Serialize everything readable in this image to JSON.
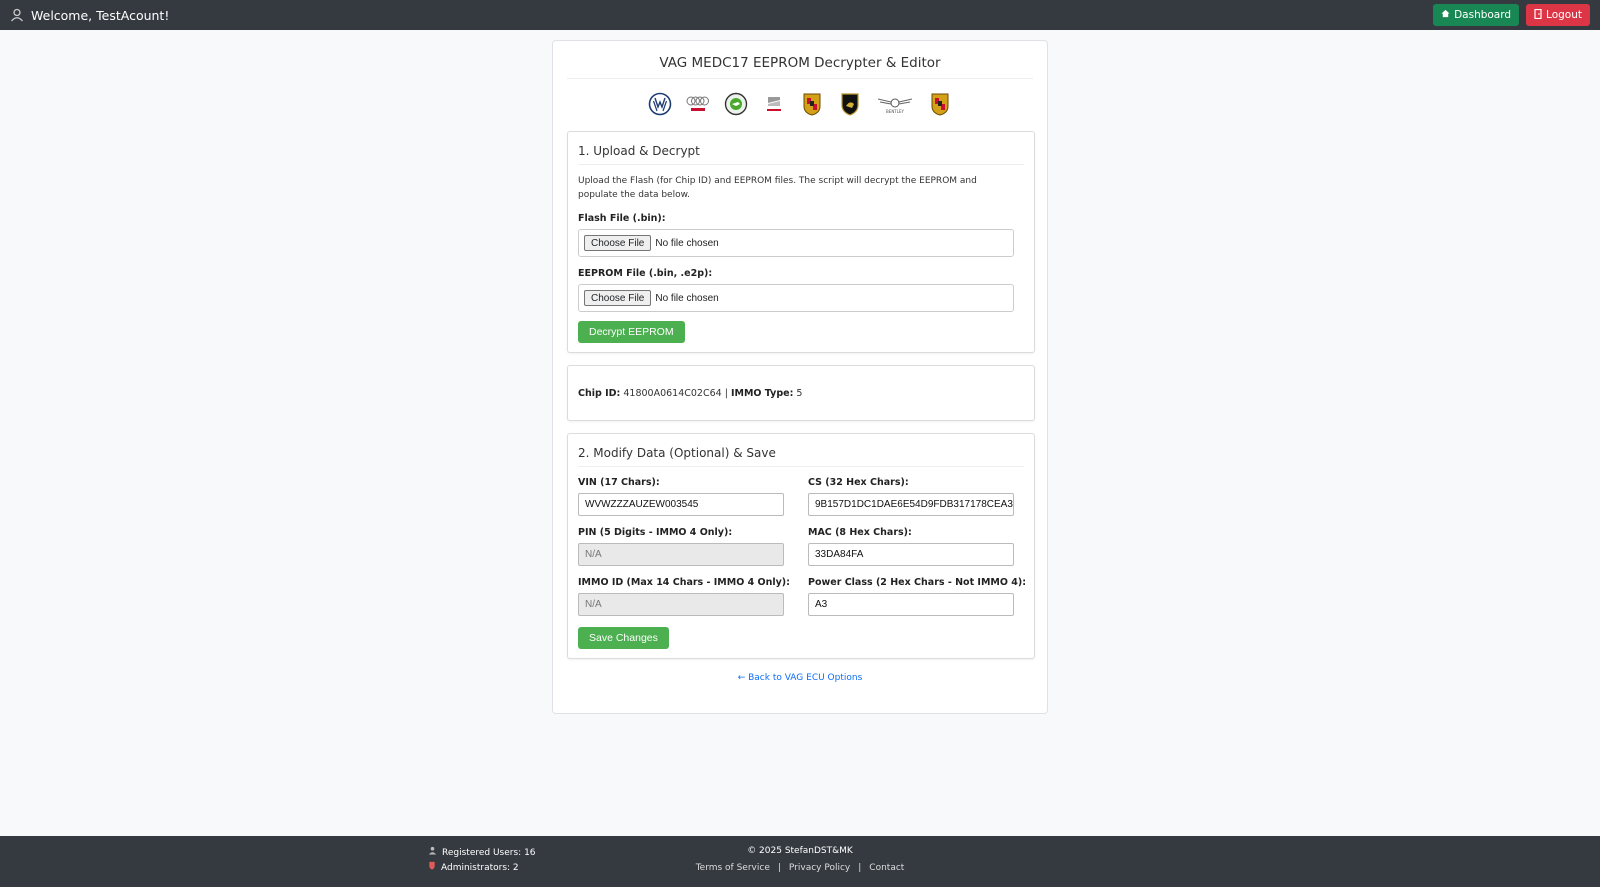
{
  "header": {
    "welcome_text": "Welcome, TestAcount!",
    "dashboard_label": "Dashboard",
    "logout_label": "Logout"
  },
  "page": {
    "title": "VAG MEDC17 EEPROM Decrypter & Editor",
    "brand_logos": [
      "vw-logo",
      "audi-logo",
      "skoda-logo",
      "seat-logo",
      "porsche-logo",
      "lamborghini-logo",
      "bentley-logo",
      "porsche-logo"
    ]
  },
  "upload": {
    "title": "1. Upload & Decrypt",
    "description": "Upload the Flash (for Chip ID) and EEPROM files. The script will decrypt the EEPROM and populate the data below.",
    "flash_label": "Flash File (.bin):",
    "eeprom_label": "EEPROM File (.bin, .e2p):",
    "choose_file_label": "Choose File",
    "no_file_text": "No file chosen",
    "decrypt_button": "Decrypt EEPROM"
  },
  "chip": {
    "chip_id_label": "Chip ID:",
    "chip_id_value": "41800A0614C02C64",
    "separator": "|",
    "immo_type_label": "IMMO Type:",
    "immo_type_value": "5"
  },
  "modify": {
    "title": "2. Modify Data (Optional) & Save",
    "vin_label": "VIN (17 Chars):",
    "vin_value": "WVWZZZAUZEW003545",
    "cs_label": "CS (32 Hex Chars):",
    "cs_value": "9B157D1DC1DAE6E54D9FDB317178CEA3",
    "pin_label": "PIN (5 Digits - IMMO 4 Only):",
    "pin_value": "N/A",
    "mac_label": "MAC (8 Hex Chars):",
    "mac_value": "33DA84FA",
    "immo_id_label": "IMMO ID (Max 14 Chars - IMMO 4 Only):",
    "immo_id_value": "N/A",
    "power_class_label": "Power Class (2 Hex Chars - Not IMMO 4):",
    "power_class_value": "A3",
    "save_button": "Save Changes"
  },
  "back_link": "← Back to VAG ECU Options",
  "footer": {
    "registered_users": "Registered Users: 16",
    "administrators": "Administrators: 2",
    "copyright": "© 2025 StefanDST&MK",
    "links": [
      "Terms of Service",
      "Privacy Policy",
      "Contact"
    ],
    "link_separator": "|"
  },
  "colors": {
    "topbar": "#343a40",
    "dashboard": "#198754",
    "logout": "#dc3545",
    "action_green": "#4caf50",
    "link": "#0d6efd"
  }
}
